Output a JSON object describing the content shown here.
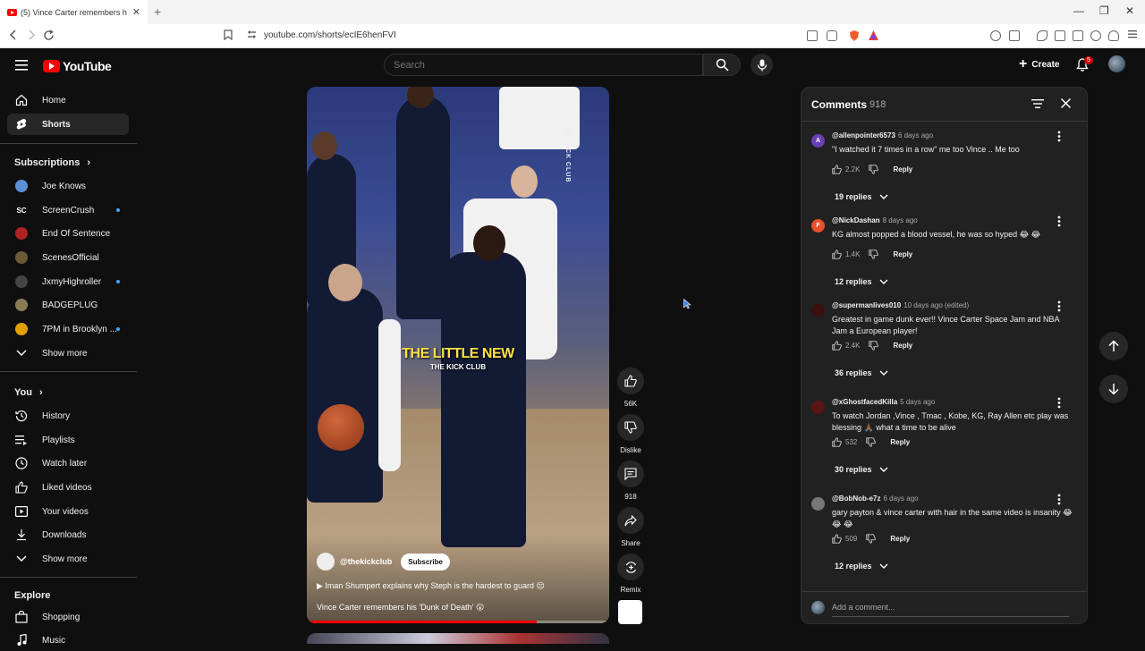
{
  "browser": {
    "tab_title": "(5) Vince Carter remembers h",
    "tab_close": "✕",
    "new_tab": "+",
    "url": "youtube.com/shorts/ecIE6henFVI"
  },
  "header": {
    "logo_text": "YouTube",
    "search_placeholder": "Search",
    "create_label": "Create",
    "notification_count": "5"
  },
  "sidebar": {
    "main": [
      {
        "label": "Home",
        "icon": "home-icon"
      },
      {
        "label": "Shorts",
        "icon": "shorts-icon",
        "active": true
      }
    ],
    "subscriptions_heading": "Subscriptions",
    "subscriptions": [
      {
        "label": "Joe Knows",
        "color": "#5b8fd6",
        "glyph": "",
        "new": false
      },
      {
        "label": "ScreenCrush",
        "color": "#0f0f0f",
        "glyph": "SC",
        "new": true
      },
      {
        "label": "End Of Sentence",
        "color": "#b22222",
        "glyph": "",
        "new": false
      },
      {
        "label": "ScenesOfficial",
        "color": "#6b5a3a",
        "glyph": "",
        "new": false
      },
      {
        "label": "JxmyHighroller",
        "color": "#444444",
        "glyph": "",
        "new": true
      },
      {
        "label": "BADGEPLUG",
        "color": "#8a7a55",
        "glyph": "",
        "new": false
      },
      {
        "label": "7PM in Brooklyn ...",
        "color": "#e0a000",
        "glyph": "",
        "new": true
      }
    ],
    "show_more_1": "Show more",
    "you_heading": "You",
    "you_items": [
      {
        "label": "History"
      },
      {
        "label": "Playlists"
      },
      {
        "label": "Watch later"
      },
      {
        "label": "Liked videos"
      },
      {
        "label": "Your videos"
      },
      {
        "label": "Downloads"
      }
    ],
    "show_more_2": "Show more",
    "explore_heading": "Explore",
    "explore_items": [
      {
        "label": "Shopping"
      },
      {
        "label": "Music"
      }
    ]
  },
  "video": {
    "watermark": "THE KICK CLUB",
    "overlay_title": "THE LITTLE NEW",
    "overlay_sub": "THE KICK CLUB",
    "channel": "@thekickclub",
    "subscribe": "Subscribe",
    "related": "▶  Iman Shumpert explains why Steph is the hardest to guard 😔",
    "title": "Vince Carter remembers his 'Dunk of Death' 😮",
    "progress": 0.76
  },
  "actions": {
    "like_count": "56K",
    "dislike_label": "Dislike",
    "comment_count": "918",
    "share_label": "Share",
    "remix_label": "Remix"
  },
  "comments": {
    "title": "Comments",
    "count": "918",
    "add_placeholder": "Add a comment...",
    "items": [
      {
        "author": "@allenpointer6573",
        "time": "6 days ago",
        "text": "\"I watched it 7 times in a row\" me too Vince .. Me too",
        "likes": "2.2K",
        "reply": "Reply",
        "replies": "19 replies",
        "avatar_letter": "A",
        "avatar_color": "#6a3fb5"
      },
      {
        "author": "@NickDashan",
        "time": "8 days ago",
        "text": "KG almost popped a blood vessel, he was so hyped 😂 😂",
        "likes": "1.4K",
        "reply": "Reply",
        "replies": "12 replies",
        "avatar_letter": "F",
        "avatar_color": "#e8502a"
      },
      {
        "author": "@supermanlives010",
        "time": "10 days ago (edited)",
        "text": "Greatest in game dunk ever!! Vince Carter Space Jam and NBA Jam a European player!",
        "likes": "2.4K",
        "reply": "Reply",
        "replies": "36 replies",
        "avatar_letter": "",
        "avatar_color": "#3a1010"
      },
      {
        "author": "@xGhostfacedKilla",
        "time": "5 days ago",
        "text": "To watch Jordan ,Vince , Tmac , Kobe, KG, Ray Allen etc play was blessing 🙏🏾 what a time to be alive",
        "likes": "532",
        "reply": "Reply",
        "replies": "30 replies",
        "avatar_letter": "",
        "avatar_color": "#5a1515"
      },
      {
        "author": "@BobNob-e7z",
        "time": "6 days ago",
        "text": "gary payton & vince carter with hair in the same video is insanity 😂 😂 😂",
        "likes": "509",
        "reply": "Reply",
        "replies": "12 replies",
        "avatar_letter": "",
        "avatar_color": "#777777"
      }
    ]
  }
}
